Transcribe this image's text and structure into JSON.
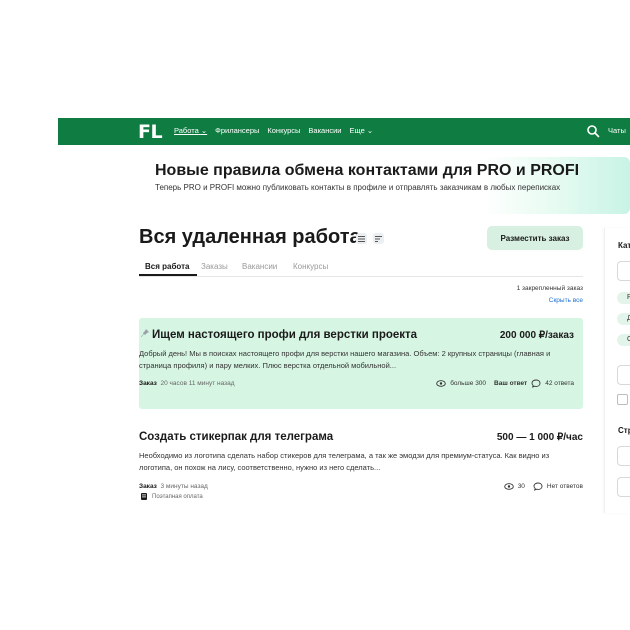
{
  "header": {
    "logo": "FL",
    "nav": [
      {
        "label": "Работа",
        "active": true,
        "dropdown": true
      },
      {
        "label": "Фрилансеры"
      },
      {
        "label": "Конкурсы"
      },
      {
        "label": "Вакансии"
      },
      {
        "label": "Еще",
        "dropdown": true
      }
    ],
    "search_icon": "search-icon",
    "chats": "Чаты",
    "bg_color": "#0f7d42"
  },
  "banner": {
    "title": "Новые правила обмена контактами для PRO и PROFI",
    "text": "Теперь PRO и PROFI можно публиковать контакты в профиле и отправлять заказчикам в любых переписках"
  },
  "main": {
    "title": "Вся удаленная работа",
    "post_button": "Разместить заказ",
    "tabs": [
      "Вся работа",
      "Заказы",
      "Вакансии",
      "Конкурсы"
    ],
    "pinned_count": "1 закрепленный заказ",
    "hide_all": "Скрыть все"
  },
  "projects": [
    {
      "title": "Ищем настоящего профи для верстки проекта",
      "price": "200 000 ₽/заказ",
      "desc": "Добрый день! Мы в поисках настоящего профи для верстки нашего магазина. Объем: 2 крупных страницы (главная и страница профиля) и пару мелких. Плюс верстка отдельной мобильной...",
      "type": "Заказ",
      "time": "20 часов 11 минут назад",
      "views": "больше 300",
      "your_answer": "Ваш ответ",
      "answers": "42 ответа",
      "pinned": true,
      "bg": "#d7f5e3"
    },
    {
      "title": "Создать стикерпак для телеграма",
      "price": "500 — 1 000 ₽/час",
      "desc": "Необходимо из логотипа сделать набор стикеров для телеграма, а так же эмодзи для премиум-статуса. Как видно из логотипа, он похож на лису, соответственно, нужно из него сделать...",
      "type": "Заказ",
      "time": "3 минуты назад",
      "payment": "Поэтапная оплата",
      "views": "30",
      "answers": "Нет ответов"
    }
  ],
  "sidebar": {
    "headings": [
      "Кат",
      "Стр"
    ],
    "chips": [
      "Р",
      "Д",
      "С"
    ]
  }
}
